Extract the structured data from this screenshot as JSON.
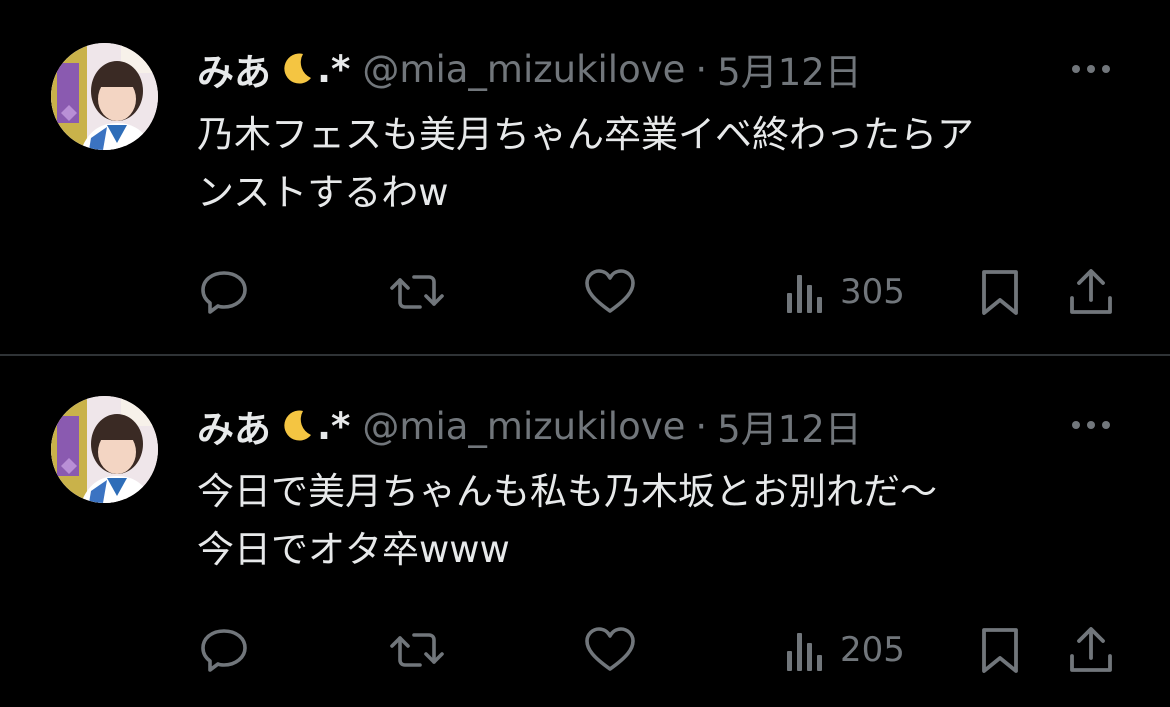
{
  "tweets": [
    {
      "author_name": "みあ",
      "name_emoji": "moon-icon",
      "name_suffix": ".*",
      "handle": "@mia_mizukilove",
      "separator": "·",
      "date": "5月12日",
      "text_lines": [
        "乃木フェスも美月ちゃん卒業イベ終わったらア",
        "ンストするわw"
      ],
      "views": "305"
    },
    {
      "author_name": "みあ",
      "name_emoji": "moon-icon",
      "name_suffix": ".*",
      "handle": "@mia_mizukilove",
      "separator": "·",
      "date": "5月12日",
      "text_lines": [
        "今日で美月ちゃんも私も乃木坂とお別れだ〜",
        "今日でオタ卒www"
      ],
      "views": "205"
    }
  ],
  "colors": {
    "background": "#000000",
    "primary_text": "#e7e9ea",
    "secondary_text": "#71767b",
    "divider": "#2f3336",
    "moon": "#f4c542"
  }
}
